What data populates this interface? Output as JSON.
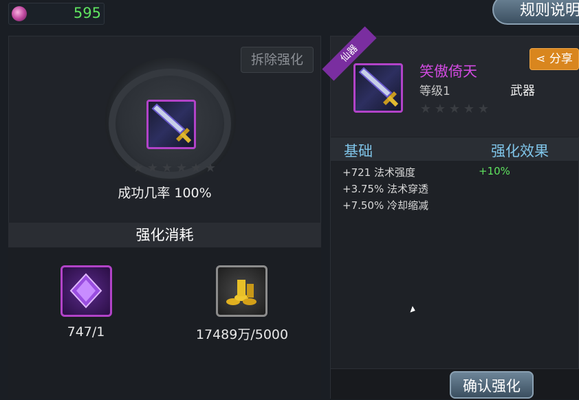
{
  "currency": {
    "value": "595",
    "icon": "crystal-swirl-icon"
  },
  "rules_button": "规则说明",
  "remove_button": "拆除强化",
  "success_rate": "成功几率 100%",
  "cost": {
    "header": "强化消耗",
    "crystal_count": "747/1",
    "gold_count": "17489万/5000"
  },
  "weapon": {
    "badge": "仙器",
    "name": "笑傲倚天",
    "level": "等级1",
    "type": "武器",
    "star_count": 0,
    "star_total": 5
  },
  "share_button": "分享",
  "stats": {
    "base_label": "基础",
    "effect_label": "强化效果",
    "lines": [
      "+721 法术强度",
      "+3.75% 法术穿透",
      "+7.50% 冷却缩减"
    ],
    "effect_value": "+10%"
  },
  "confirm_button": "确认强化",
  "colors": {
    "accent_purple": "#b243c8",
    "green": "#5fe35f",
    "orange": "#d9861e",
    "label_blue": "#7fc4e8"
  }
}
